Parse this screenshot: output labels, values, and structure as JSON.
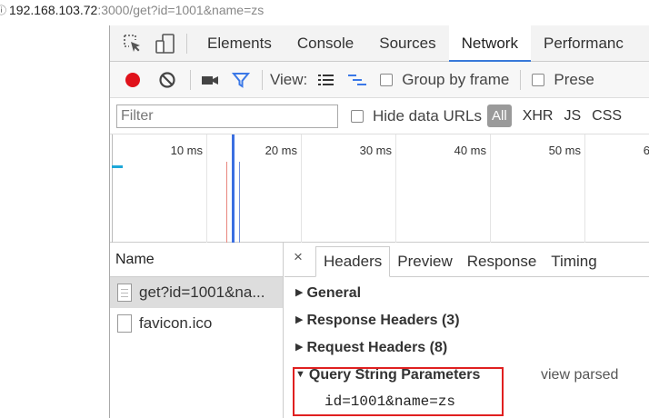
{
  "address": {
    "info_icon": "info-icon",
    "host": "192.168.103.72",
    "rest": ":3000/get?id=1001&name=zs"
  },
  "devtools": {
    "tabs": [
      {
        "label": "Elements",
        "active": false
      },
      {
        "label": "Console",
        "active": false
      },
      {
        "label": "Sources",
        "active": false
      },
      {
        "label": "Network",
        "active": true
      },
      {
        "label": "Performanc",
        "active": false
      }
    ],
    "toolbar": {
      "record_color": "#e0121b",
      "view_label": "View:",
      "group_by_frame": "Group by frame",
      "preserve_log": "Prese"
    },
    "filterbar": {
      "filter_placeholder": "Filter",
      "hide_data_urls": "Hide data URLs",
      "all": "All",
      "types": [
        "XHR",
        "JS",
        "CSS"
      ]
    },
    "timeline": {
      "ticks": [
        "10 ms",
        "20 ms",
        "30 ms",
        "40 ms",
        "50 ms",
        "6"
      ]
    },
    "requests": {
      "header": "Name",
      "items": [
        {
          "name": "get?id=1001&na...",
          "selected": true
        },
        {
          "name": "favicon.ico",
          "selected": false
        }
      ]
    },
    "detail": {
      "close": "×",
      "tabs": [
        "Headers",
        "Preview",
        "Response",
        "Timing"
      ],
      "sections": {
        "general": "General",
        "response_headers": "Response Headers (3)",
        "request_headers": "Request Headers (8)",
        "query": "Query String Parameters"
      },
      "view_parsed": "view parsed",
      "query_value": "id=1001&name=zs"
    }
  }
}
